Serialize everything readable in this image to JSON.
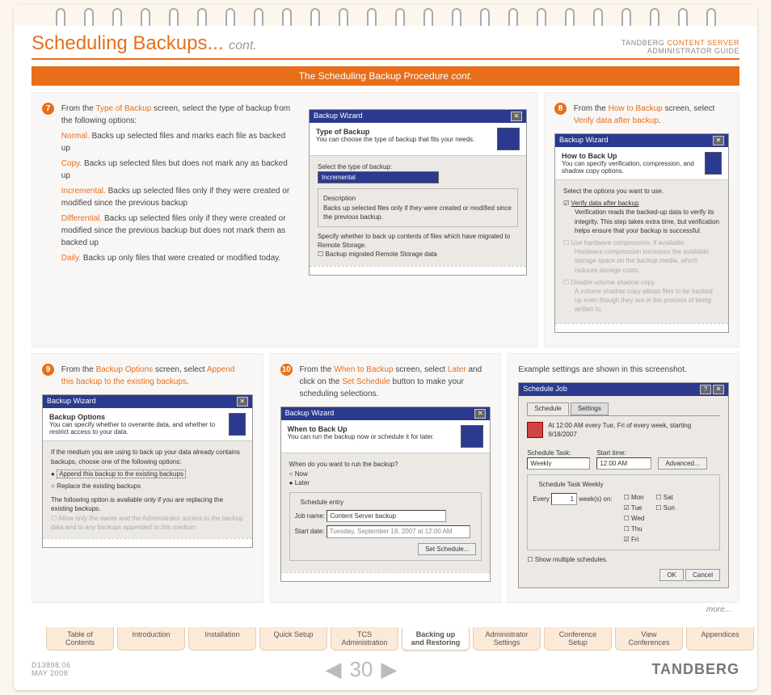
{
  "header": {
    "title_main": "Scheduling Backups...",
    "title_cont": "cont.",
    "right_line1a": "TANDBERG ",
    "right_line1b": "CONTENT SERVER",
    "right_line2": "ADMINISTRATOR GUIDE"
  },
  "band": {
    "text": "The Scheduling Backup Procedure ",
    "cont": "cont."
  },
  "step7": {
    "num": "7",
    "intro_a": "From the ",
    "intro_b": "Type of Backup",
    "intro_c": " screen, select the type of backup from the following options:",
    "options": [
      {
        "name": "Normal.",
        "desc": " Backs up selected files and marks each file as backed up"
      },
      {
        "name": "Copy.",
        "desc": " Backs up selected files but does not mark any as backed up"
      },
      {
        "name": "Incremental.",
        "desc": " Backs up selected files only if they were created or modified since the previous backup"
      },
      {
        "name": "Differential.",
        "desc": " Backs up selected files only if they were created or modified since the previous backup but does not mark them as backed up"
      },
      {
        "name": "Daily.",
        "desc": " Backs up only files that were created or modified today."
      }
    ],
    "dlg": {
      "title": "Backup Wizard",
      "head_bold": "Type of Backup",
      "head_sub": "You can choose the type of backup that fits your needs.",
      "label_select": "Select the type of backup:",
      "dropdown": "Incremental",
      "desc_label": "Description",
      "desc_text": "Backs up selected files only if they were created or modified since the previous backup.",
      "note": "Specify whether to back up contents of files which have migrated to Remote Storage.",
      "chk": "Backup migrated Remote Storage data"
    }
  },
  "step8": {
    "num": "8",
    "intro_a": "From the ",
    "intro_b": "How to Backup",
    "intro_c": " screen, select ",
    "intro_d": "Verify data after backup",
    "intro_e": ".",
    "dlg": {
      "title": "Backup Wizard",
      "head_bold": "How to Back Up",
      "head_sub": "You can specify verification, compression, and shadow copy options.",
      "label_select": "Select the options you want to use.",
      "opt1_label": "Verify data after backup",
      "opt1_desc": "Verification reads the backed-up data to verify its integrity. This step takes extra time, but verification helps ensure that your backup is successful.",
      "opt2_label": "Use hardware compression, if available",
      "opt2_desc": "Hardware compression increases the available storage space on the backup media, which reduces storage costs.",
      "opt3_label": "Disable volume shadow copy",
      "opt3_desc": "A volume shadow copy allows files to be backed up even though they are in the process of being written to."
    }
  },
  "step9": {
    "num": "9",
    "intro_a": "From the ",
    "intro_b": "Backup Options",
    "intro_c": " screen, select ",
    "intro_d": "Append this backup to the existing backups",
    "intro_e": ".",
    "dlg": {
      "title": "Backup Wizard",
      "head_bold": "Backup Options",
      "head_sub": "You can specify whether to overwrite data, and whether to restrict access to your data.",
      "lead": "If the medium you are using to back up your data already contains backups, choose one of the following options:",
      "opt1": "Append this backup to the existing backups",
      "opt2": "Replace the existing backups",
      "note": "The following option is available only if you are replacing the existing backups.",
      "chk": "Allow only the owner and the Administrator access to the backup data and to any backups appended to this medium"
    }
  },
  "step10": {
    "num": "10",
    "intro_a": "From the ",
    "intro_b": "When to Backup",
    "intro_c": " screen, select ",
    "intro_d": "Later",
    "intro_e": " and click on the ",
    "intro_f": "Set Schedule",
    "intro_g": " button to make your scheduling selections.",
    "dlg": {
      "title": "Backup Wizard",
      "head_bold": "When to Back Up",
      "head_sub": "You can run the backup now or schedule it for later.",
      "q": "When do you want to run the backup?",
      "opt_now": "Now",
      "opt_later": "Later",
      "group_label": "Schedule entry",
      "job_label": "Job name:",
      "job_value": "Content Server backup",
      "start_label": "Start date:",
      "start_value": "Tuesday, September 18, 2007 at 12:00 AM",
      "btn": "Set Schedule..."
    }
  },
  "step11": {
    "intro": "Example settings are shown in this screenshot.",
    "dlg": {
      "title": "Schedule Job",
      "tab1": "Schedule",
      "tab2": "Settings",
      "summary": "At 12:00 AM every Tue, Fri of every week, starting 9/18/2007",
      "task_label": "Schedule Task:",
      "task_value": "Weekly",
      "time_label": "Start time:",
      "time_value": "12:00 AM",
      "adv": "Advanced...",
      "weekly_group": "Schedule Task Weekly",
      "every_a": "Every",
      "every_val": "1",
      "every_b": "week(s) on:",
      "days": {
        "mon": "Mon",
        "tue": "Tue",
        "wed": "Wed",
        "thu": "Thu",
        "fri": "Fri",
        "sat": "Sat",
        "sun": "Sun"
      },
      "show_multi": "Show multiple schedules.",
      "ok": "OK",
      "cancel": "Cancel"
    }
  },
  "more": "more...",
  "tabs": [
    "Table of Contents",
    "Introduction",
    "Installation",
    "Quick Setup",
    "TCS Administration",
    "Backing up and Restoring",
    "Administrator Settings",
    "Conference Setup",
    "View Conferences",
    "Appendices"
  ],
  "active_tab_index": 5,
  "footer": {
    "doc1": "D13898.06",
    "doc2": "MAY 2008",
    "page": "30",
    "brand": "TANDBERG"
  }
}
